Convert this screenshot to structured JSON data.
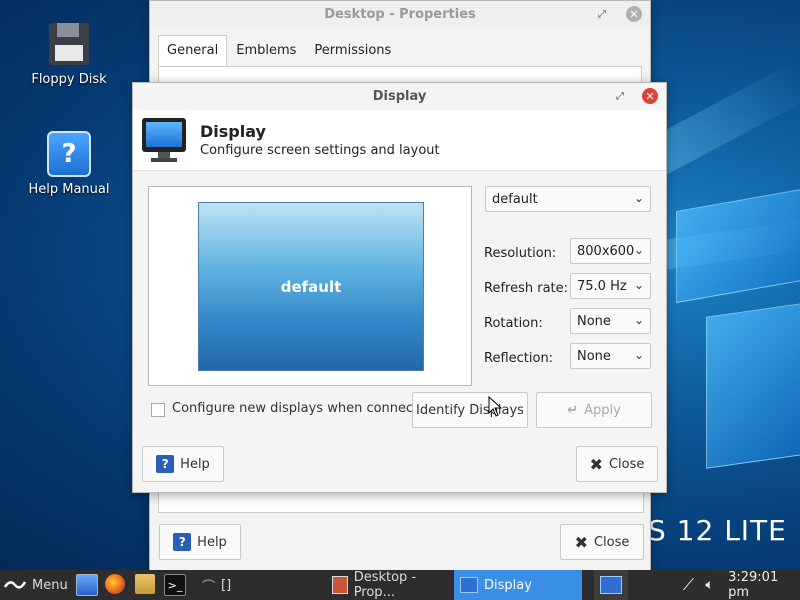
{
  "desktop": {
    "icons": [
      {
        "label": "Floppy Disk"
      },
      {
        "label": "Help Manual"
      }
    ],
    "branding_text": "S 12 LITE"
  },
  "properties_window": {
    "title": "Desktop - Properties",
    "tabs": [
      "General",
      "Emblems",
      "Permissions"
    ],
    "help_label": "Help",
    "close_label": "Close"
  },
  "display_dialog": {
    "title": "Display",
    "header_title": "Display",
    "header_subtitle": "Configure screen settings and layout",
    "preview_label": "default",
    "output_select": "default",
    "resolution_label": "Resolution:",
    "resolution_value": "800x600",
    "refresh_label": "Refresh rate:",
    "refresh_value": "75.0 Hz",
    "rotation_label": "Rotation:",
    "rotation_value": "None",
    "reflection_label": "Reflection:",
    "reflection_value": "None",
    "configure_checkbox_label": "Configure new displays when connected",
    "configure_checked": false,
    "identify_label": "Identify Displays",
    "apply_label": "Apply",
    "help_label": "Help",
    "close_label": "Close"
  },
  "taskbar": {
    "menu_label": "Menu",
    "terminal_label": "[]",
    "tasks": [
      {
        "label": "Desktop - Prop..."
      },
      {
        "label": "Display"
      }
    ],
    "clock": "3:29:01 pm"
  },
  "colors": {
    "accent": "#3a8ee6",
    "taskbar_bg": "#2d2d2d",
    "close_red": "#e0403a"
  }
}
